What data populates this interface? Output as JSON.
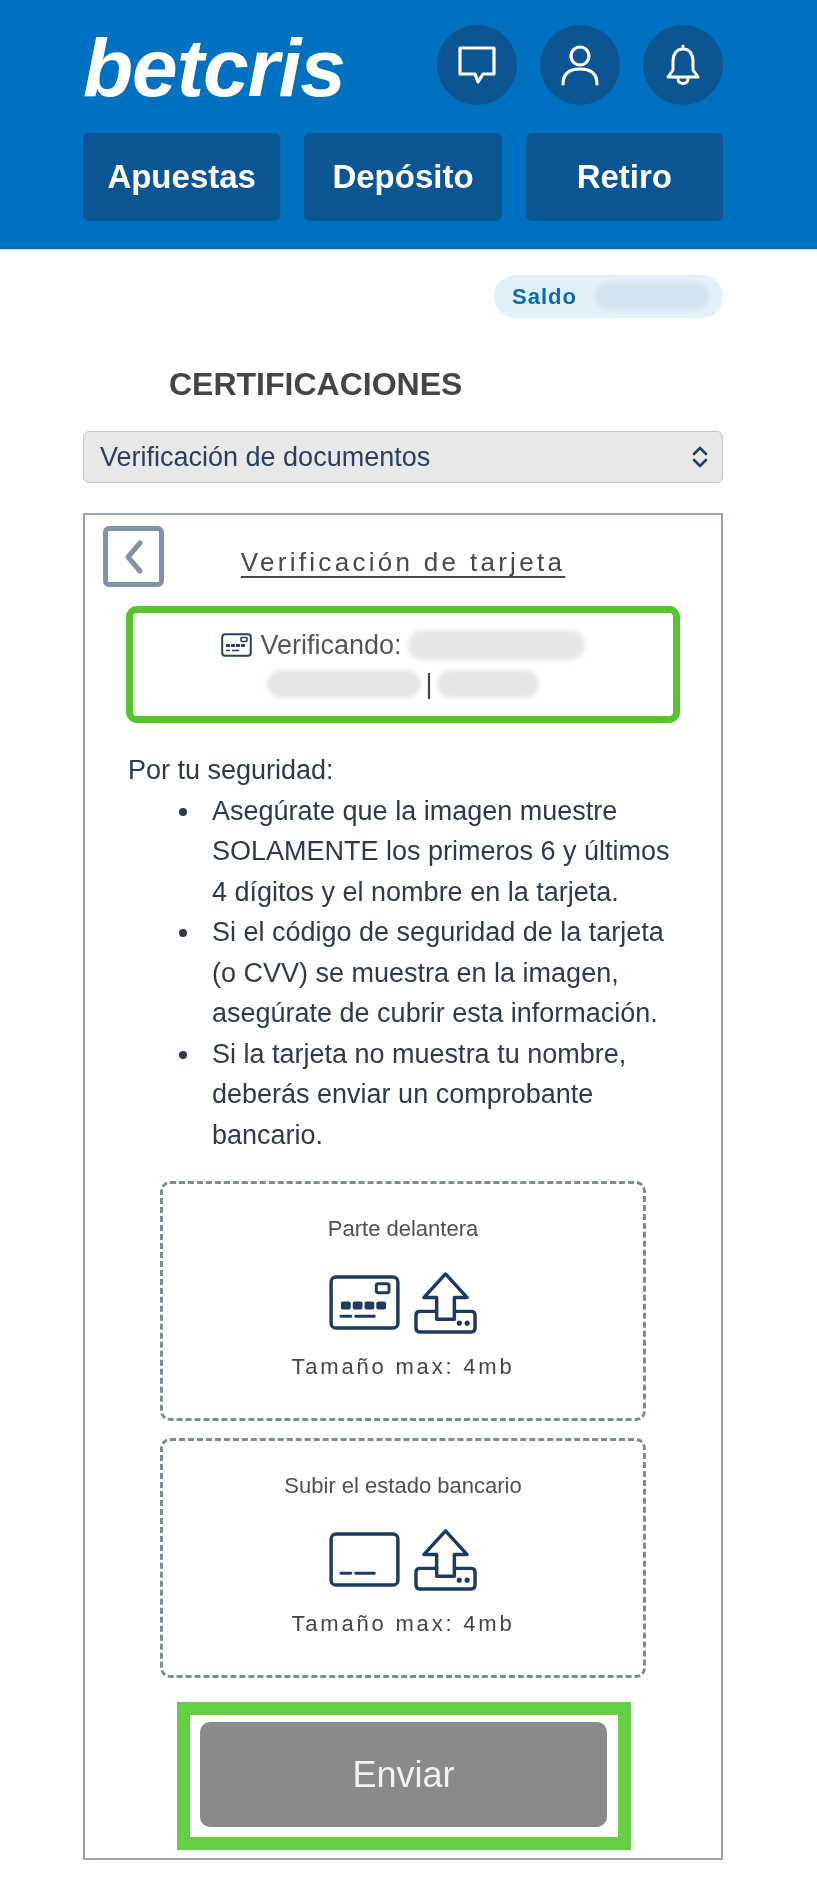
{
  "header": {
    "logo": "betcris",
    "nav": [
      {
        "label": "Apuestas"
      },
      {
        "label": "Depósito"
      },
      {
        "label": "Retiro"
      }
    ]
  },
  "balance": {
    "label": "Saldo"
  },
  "page_title": "CERTIFICACIONES",
  "section_select": {
    "value": "Verificación de documentos"
  },
  "card": {
    "title": "Verificación de tarjeta",
    "verifying": {
      "label": "Verificando:",
      "separator": "|",
      "highlighted": true
    },
    "intro": "Por tu seguridad:",
    "tips": [
      "Asegúrate que la imagen muestre SOLAMENTE los primeros 6 y últimos 4 dígitos y el nombre en la tarjeta.",
      "Si el código de seguridad de la tarjeta (o CVV) se muestra en la imagen, asegúrate de cubrir esta información.",
      "Si la tarjeta no muestra tu nombre, deberás enviar un comprobante bancario."
    ],
    "uploads": [
      {
        "kind": "card_front",
        "label": "Parte delantera",
        "size_hint": "Tamaño max: 4mb"
      },
      {
        "kind": "statement",
        "label": "Subir el estado bancario",
        "size_hint": "Tamaño max: 4mb"
      }
    ],
    "submit": {
      "label": "Enviar",
      "disabled": true,
      "highlighted": true
    }
  }
}
